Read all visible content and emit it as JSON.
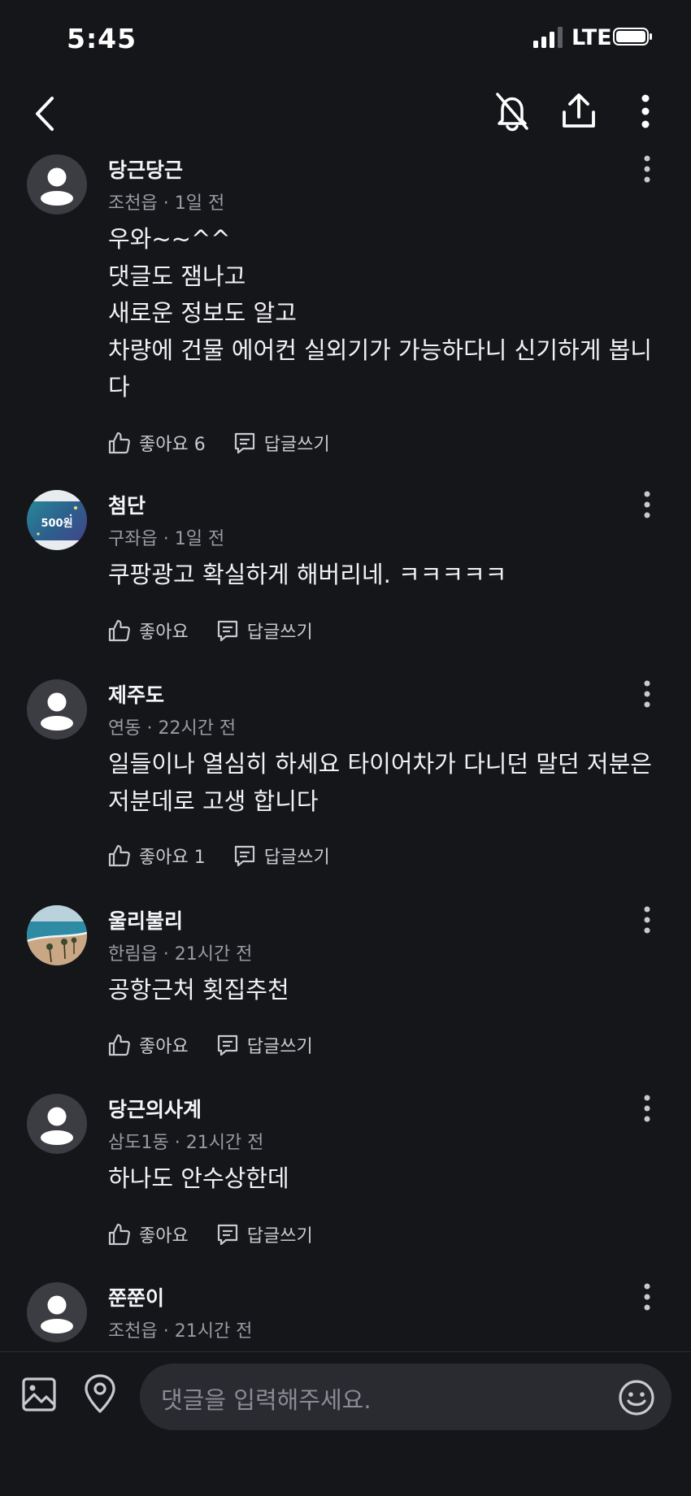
{
  "status_bar": {
    "time": "5:45",
    "network": "LTE"
  },
  "comments": [
    {
      "author": "당근당근",
      "location": "조천읍",
      "time_ago": "1일 전",
      "text": "우와~~^^\n댓글도 잼나고\n새로운 정보도 알고\n차량에 건물 에어컨 실외기가 가능하다니 신기하게 봅니다",
      "like_label": "좋아요 6",
      "reply_label": "답글쓰기",
      "avatar": "default-avatar"
    },
    {
      "author": "첨단",
      "location": "구좌읍",
      "time_ago": "1일 전",
      "text": "쿠팡광고 확실하게 해버리네. ㅋㅋㅋㅋㅋ",
      "like_label": "좋아요",
      "reply_label": "답글쓰기",
      "avatar": "coin-avatar",
      "avatar_text": "500원"
    },
    {
      "author": "제주도",
      "location": "연동",
      "time_ago": "22시간 전",
      "text": "일들이나 열심히 하세요 타이어차가 다니던 말던 저분은 저분데로 고생 합니다",
      "like_label": "좋아요 1",
      "reply_label": "답글쓰기",
      "avatar": "default-avatar"
    },
    {
      "author": "울리불리",
      "location": "한림읍",
      "time_ago": "21시간 전",
      "text": "공항근처 횟집추천",
      "like_label": "좋아요",
      "reply_label": "답글쓰기",
      "avatar": "beach-photo-avatar"
    },
    {
      "author": "당근의사계",
      "location": "삼도1동",
      "time_ago": "21시간 전",
      "text": "하나도 안수상한데",
      "like_label": "좋아요",
      "reply_label": "답글쓰기",
      "avatar": "default-avatar"
    },
    {
      "author": "쭌쭌이",
      "location": "조천읍",
      "time_ago": "21시간 전",
      "avatar": "default-avatar"
    }
  ],
  "composer": {
    "placeholder": "댓글을 입력해주세요."
  },
  "colors": {
    "background": "#15161a",
    "muted": "#9a9ba2",
    "input_bg": "#2a2b31",
    "avatar_default": "#3c3d43"
  }
}
